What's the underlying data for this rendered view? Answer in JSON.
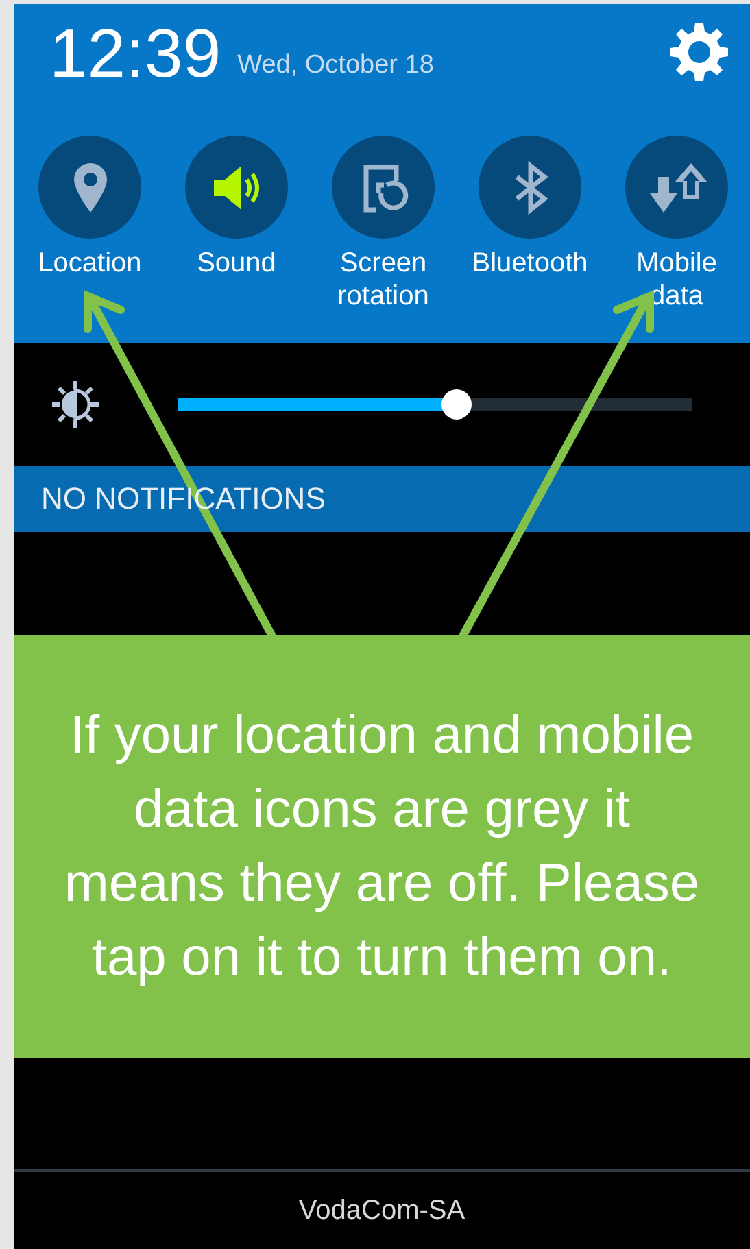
{
  "status": {
    "time": "12:39",
    "date": "Wed, October 18"
  },
  "quick_settings": [
    {
      "label": "Location",
      "kind": "location",
      "on": false
    },
    {
      "label": "Sound",
      "kind": "sound",
      "on": true
    },
    {
      "label": "Screen rotation",
      "kind": "rotation",
      "on": false
    },
    {
      "label": "Bluetooth",
      "kind": "bluetooth",
      "on": false
    },
    {
      "label": "Mobile data",
      "kind": "data",
      "on": false
    }
  ],
  "brightness": {
    "level": 0.54
  },
  "notifications": {
    "label": "NO NOTIFICATIONS"
  },
  "callout": {
    "text": "If your location and mobile data icons are grey it means they are off. Please tap on it to turn them on."
  },
  "carrier": "VodaCom-SA"
}
